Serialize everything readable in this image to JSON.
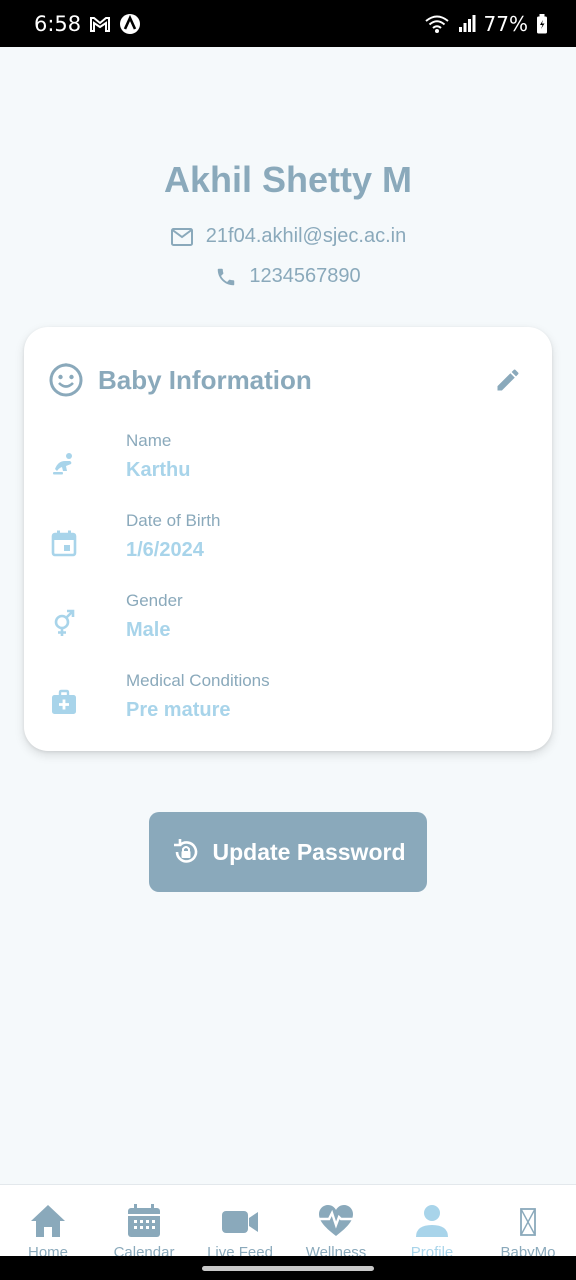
{
  "status_bar": {
    "time": "6:58",
    "battery": "77%"
  },
  "profile": {
    "name": "Akhil Shetty M",
    "email": "21f04.akhil@sjec.ac.in",
    "phone": "1234567890"
  },
  "baby_info": {
    "title": "Baby Information",
    "fields": [
      {
        "label": "Name",
        "value": "Karthu",
        "icon": "baby-icon"
      },
      {
        "label": "Date of Birth",
        "value": "1/6/2024",
        "icon": "calendar-icon"
      },
      {
        "label": "Gender",
        "value": "Male",
        "icon": "gender-icon"
      },
      {
        "label": "Medical Conditions",
        "value": "Pre mature",
        "icon": "medical-kit-icon"
      }
    ]
  },
  "update_button": {
    "label": "Update Password"
  },
  "nav": {
    "items": [
      {
        "label": "Home",
        "icon": "home-icon"
      },
      {
        "label": "Calendar",
        "icon": "calendar-icon"
      },
      {
        "label": "Live Feed",
        "icon": "video-camera-icon"
      },
      {
        "label": "Wellness",
        "icon": "heart-pulse-icon"
      },
      {
        "label": "Profile",
        "icon": "person-icon"
      },
      {
        "label": "BabyMo",
        "icon": "hourglass-icon"
      }
    ],
    "active_index": 4
  },
  "colors": {
    "primary": "#8aa9bb",
    "accent": "#a8d4ea",
    "background": "#f5f9fb"
  }
}
